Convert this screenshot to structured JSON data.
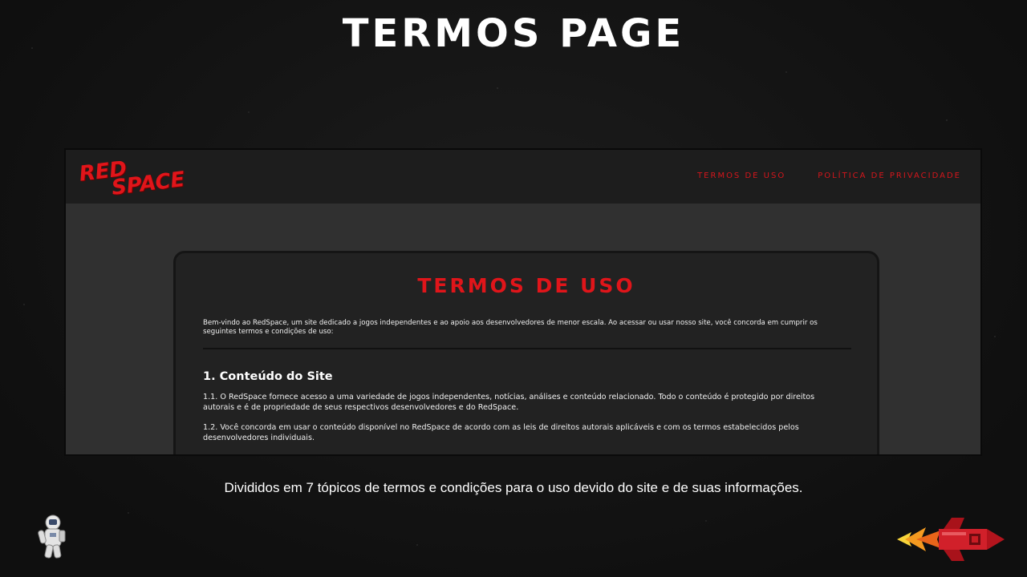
{
  "slide": {
    "title": "Termos Page",
    "caption": "Divididos em 7 tópicos de termos e condições para o uso devido do site e de suas informações."
  },
  "site": {
    "logo": {
      "line1": "RED",
      "line2": "SPACE"
    },
    "nav": [
      {
        "label": "Termos de uso"
      },
      {
        "label": "Política de privacidade"
      }
    ],
    "card": {
      "title": "Termos de uso",
      "intro": "Bem-vindo ao RedSpace, um site dedicado a jogos independentes e ao apoio aos desenvolvedores de menor escala. Ao acessar ou usar nosso site, você concorda em cumprir os seguintes termos e condições de uso:",
      "section_heading": "1. Conteúdo do Site",
      "paragraphs": [
        "1.1. O RedSpace fornece acesso a uma variedade de jogos independentes, notícias, análises e conteúdo relacionado. Todo o conteúdo é protegido por direitos autorais e é de propriedade de seus respectivos desenvolvedores e do RedSpace.",
        "1.2. Você concorda em usar o conteúdo disponível no RedSpace de acordo com as leis de direitos autorais aplicáveis e com os termos estabelecidos pelos desenvolvedores individuais."
      ]
    }
  },
  "colors": {
    "accent_red": "#e0151a",
    "header_bg": "#1d1d1d",
    "card_bg": "#222222",
    "page_bg": "#303030"
  },
  "icons": [
    "astronaut-icon",
    "rocket-icon"
  ]
}
